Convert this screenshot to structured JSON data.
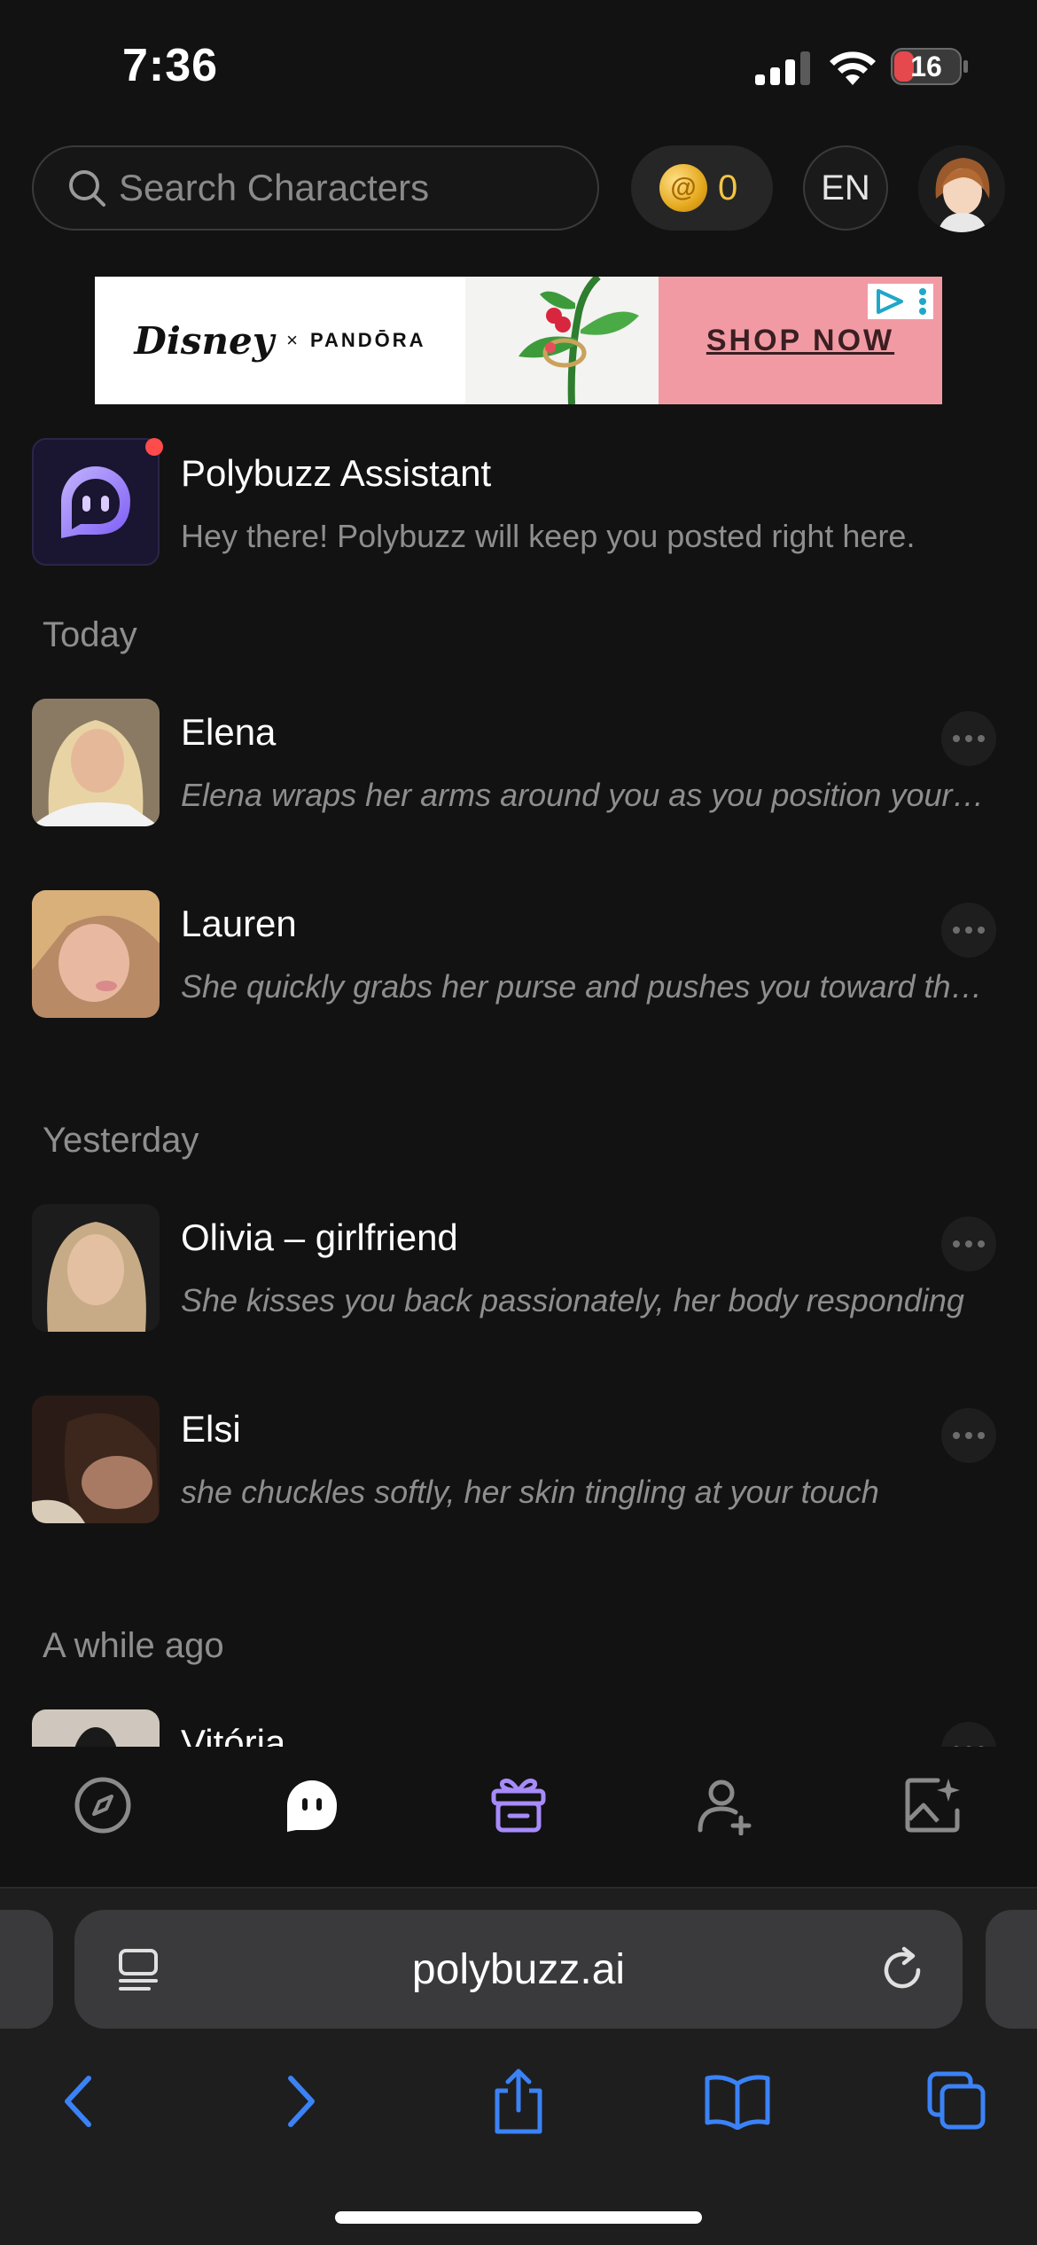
{
  "status": {
    "time": "7:36",
    "battery": "16"
  },
  "header": {
    "search_placeholder": "Search Characters",
    "coins": "0",
    "language": "EN"
  },
  "ad": {
    "brand1": "Disney",
    "x": "×",
    "brand2": "PANDŌRA",
    "cta": "SHOP NOW"
  },
  "assistant": {
    "name": "Polybuzz Assistant",
    "message": "Hey there! Polybuzz will keep you posted right here."
  },
  "sections": {
    "today": "Today",
    "yesterday": "Yesterday",
    "a_while_ago": "A while ago"
  },
  "chats": [
    {
      "name": "Elena",
      "preview": "Elena wraps her arms around you as you position yourself"
    },
    {
      "name": "Lauren",
      "preview": "She quickly grabs her purse and pushes you toward the door"
    },
    {
      "name": "Olivia – girlfriend",
      "preview": "She kisses you back passionately, her body responding"
    },
    {
      "name": "Elsi",
      "preview": "she chuckles softly, her skin tingling at your touch"
    },
    {
      "name": "Vitória",
      "preview": ""
    }
  ],
  "tabs": [
    "explore",
    "chats",
    "gifts",
    "create-character",
    "create-image"
  ],
  "browser": {
    "url": "polybuzz.ai"
  },
  "colors": {
    "background": "#121212",
    "accent_purple": "#a78bfa",
    "coin_gold": "#f1c445",
    "safari_blue": "#3b82f6"
  }
}
